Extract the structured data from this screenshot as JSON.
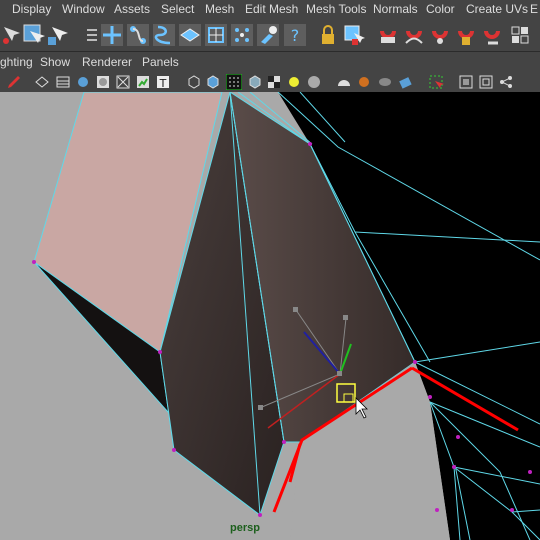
{
  "menu": {
    "items": [
      "Display",
      "Window",
      "Assets",
      "Select",
      "Mesh",
      "Edit Mesh",
      "Mesh Tools",
      "Normals",
      "Color",
      "Create UVs",
      "E"
    ]
  },
  "panel_menu": {
    "items": [
      "ghting",
      "Show",
      "Renderer",
      "Panels"
    ]
  },
  "toolbar_icons": [
    "select-tool-icon",
    "lasso-select-icon",
    "paint-select-icon",
    "tool-settings-icon",
    "move-tool-icon",
    "rotate-tool-icon",
    "curve-tool-icon",
    "multi-cut-icon",
    "extrude-icon",
    "bevel-icon",
    "sculpt-icon",
    "help-icon",
    "lock-icon",
    "component-select-icon",
    "snap-to-curve-icon",
    "snap-to-point-icon",
    "snap-to-view-icon",
    "snap-live-icon",
    "history-icon",
    "render-region-icon"
  ],
  "viewport_icons": [
    "pencil-icon",
    "wireframe-icon",
    "smooth-shade-icon",
    "flat-shade-icon",
    "bounding-box-icon",
    "x-ray-icon",
    "textured-icon",
    "isolate-icon",
    "grid-icon",
    "shaded-wireframe-icon",
    "xray-joints-icon",
    "lights-icon",
    "shadows-icon",
    "ambient-occlusion-icon",
    "motion-blur-icon",
    "anti-alias-icon",
    "depth-of-field-icon",
    "camera-gate-icon",
    "resolution-gate-icon",
    "safe-title-icon",
    "share-icon"
  ],
  "viewport": {
    "camera_label": "persp"
  },
  "colors": {
    "ui_bg": "#444444",
    "viewport_bg": "#a9a9a9",
    "wire": "#5fd8e8",
    "selected_edge": "#ff0000",
    "vertex": "#c020c0",
    "pink_face": "#c9a7a3",
    "dark_face": "#3a302f"
  }
}
